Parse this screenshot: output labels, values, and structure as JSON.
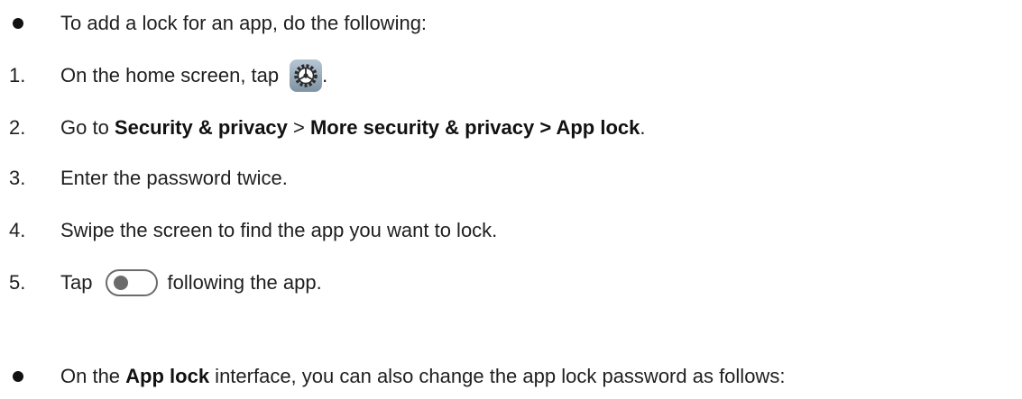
{
  "items": [
    {
      "marker": "bullet",
      "text": "To add a lock for an app, do the following:"
    },
    {
      "marker": "1.",
      "prefix": "On the home screen, tap",
      "icon": "settings-gear-icon",
      "suffix": "."
    },
    {
      "marker": "2.",
      "prefix": "Go to ",
      "b1": "Security & privacy",
      "mid": " > ",
      "b2": "More security & privacy > App lock",
      "suffix": "."
    },
    {
      "marker": "3.",
      "text": "Enter the password twice."
    },
    {
      "marker": "4.",
      "text": "Swipe the screen to find the app you want to lock."
    },
    {
      "marker": "5.",
      "prefix": "Tap",
      "icon": "toggle-switch-off-icon",
      "suffix": "following the app."
    },
    {
      "marker": "bullet",
      "prefix": "On the ",
      "bold": "App lock",
      "suffix": " interface, you can also change the app lock password as follows:"
    }
  ],
  "colors": {
    "text": "#1f1f1f",
    "gear_tile": "#8ea1b0",
    "toggle": "#6b6b6b"
  }
}
